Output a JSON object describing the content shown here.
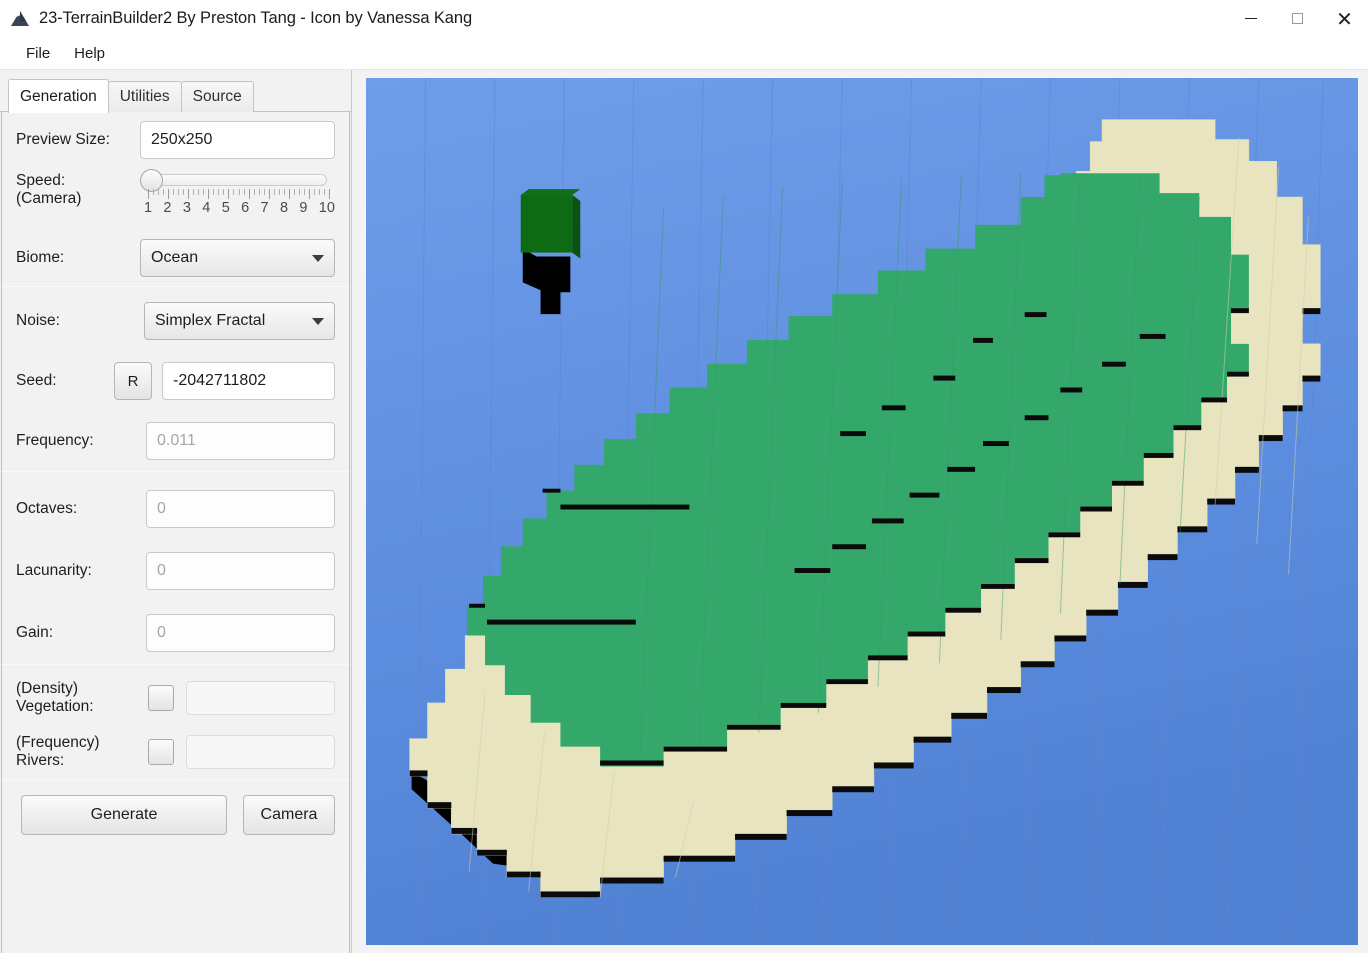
{
  "window": {
    "title": "23-TerrainBuilder2 By Preston Tang - Icon by Vanessa Kang",
    "app_icon": "mountain-icon",
    "controls": {
      "minimize": "—",
      "maximize": "□",
      "close": "✕"
    }
  },
  "menubar": {
    "items": [
      {
        "label": "File"
      },
      {
        "label": "Help"
      }
    ]
  },
  "tabs": [
    {
      "label": "Generation",
      "active": true
    },
    {
      "label": "Utilities",
      "active": false
    },
    {
      "label": "Source",
      "active": false
    }
  ],
  "generation": {
    "preview_size": {
      "label": "Preview Size:",
      "value": "250x250"
    },
    "speed": {
      "label_line1": "Speed:",
      "label_line2": "(Camera)",
      "value": 1,
      "min": 1,
      "max": 10,
      "ticks": [
        "1",
        "2",
        "3",
        "4",
        "5",
        "6",
        "7",
        "8",
        "9",
        "10"
      ]
    },
    "biome": {
      "label": "Biome:",
      "value": "Ocean",
      "caret": "chevron-down-icon"
    },
    "noise": {
      "label": "Noise:",
      "value": "Simplex Fractal",
      "caret": "chevron-down-icon"
    },
    "seed": {
      "label": "Seed:",
      "randomize_button": "R",
      "value": "-2042711802"
    },
    "frequency": {
      "label": "Frequency:",
      "placeholder": "0.011",
      "value": ""
    },
    "octaves": {
      "label": "Octaves:",
      "placeholder": "0",
      "value": ""
    },
    "lacunarity": {
      "label": "Lacunarity:",
      "placeholder": "0",
      "value": ""
    },
    "gain": {
      "label": "Gain:",
      "placeholder": "0",
      "value": ""
    },
    "vegetation": {
      "label_line1": "(Density)",
      "label_line2": "Vegetation:",
      "checked": false,
      "value": ""
    },
    "rivers": {
      "label_line1": "(Frequency)",
      "label_line2": "Rivers:",
      "checked": false,
      "value": ""
    },
    "generate_button": "Generate",
    "camera_button": "Camera"
  },
  "viewport": {
    "name": "terrain-preview-3d",
    "scene": "voxel island with beach rim, grass plateau and a single tree",
    "colors": {
      "ocean_top": "#6f9de9",
      "ocean_bottom": "#5585d6",
      "sand": "#e8e4c0",
      "sand_shadow": "#cfcba8",
      "grass": "#34a86b",
      "grass_dark": "#2e9a61",
      "tree_leaves": "#0d6b14",
      "tree_leaves_side": "#0a5410",
      "shadow": "#000000"
    }
  }
}
